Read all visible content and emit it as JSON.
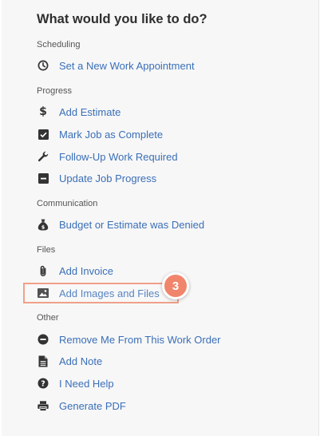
{
  "title": "What would you like to do?",
  "sections": {
    "scheduling": {
      "label": "Scheduling",
      "items": [
        {
          "label": "Set a New Work Appointment",
          "icon": "clock-icon"
        }
      ]
    },
    "progress": {
      "label": "Progress",
      "items": [
        {
          "label": "Add Estimate",
          "icon": "dollar-icon"
        },
        {
          "label": "Mark Job as Complete",
          "icon": "checkbox-icon"
        },
        {
          "label": "Follow-Up Work Required",
          "icon": "wrench-icon"
        },
        {
          "label": "Update Job Progress",
          "icon": "minus-square-icon"
        }
      ]
    },
    "communication": {
      "label": "Communication",
      "items": [
        {
          "label": "Budget or Estimate was Denied",
          "icon": "money-bag-icon"
        }
      ]
    },
    "files": {
      "label": "Files",
      "items": [
        {
          "label": "Add Invoice",
          "icon": "paperclip-icon"
        },
        {
          "label": "Add Images and Files",
          "icon": "image-icon"
        }
      ]
    },
    "other": {
      "label": "Other",
      "items": [
        {
          "label": "Remove Me From This Work Order",
          "icon": "minus-circle-icon"
        },
        {
          "label": "Add Note",
          "icon": "note-icon"
        },
        {
          "label": "I Need Help",
          "icon": "question-circle-icon"
        },
        {
          "label": "Generate PDF",
          "icon": "printer-icon"
        }
      ]
    }
  },
  "callout": {
    "step": "3",
    "color": "#f0856b",
    "highlight_color": "#f0a08a"
  },
  "colors": {
    "link": "#3a6fb8",
    "icon": "#333333",
    "panel_bg": "#f7f7f7"
  }
}
